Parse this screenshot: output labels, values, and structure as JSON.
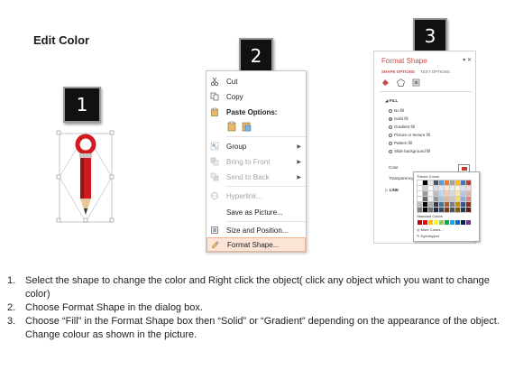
{
  "page_title": "Edit Color",
  "badges": [
    "1",
    "2",
    "3"
  ],
  "context_menu": {
    "cut": "Cut",
    "copy": "Copy",
    "paste_options": "Paste Options:",
    "group": "Group",
    "bring_to_front": "Bring to Front",
    "send_to_back": "Send to Back",
    "hyperlink": "Hyperlink...",
    "save_as_picture": "Save as Picture...",
    "size_and_position": "Size and Position...",
    "format_shape": "Format Shape..."
  },
  "format_pane": {
    "title": "Format Shape",
    "tabs": [
      "SHAPE OPTIONS",
      "TEXT OPTIONS"
    ],
    "fill_section": "FILL",
    "fill_options": [
      "No fill",
      "Solid fill",
      "Gradient fill",
      "Picture or texture fill",
      "Pattern fill",
      "Slide background fill"
    ],
    "selected_fill": "Solid fill",
    "color_label": "Color",
    "transparency_label": "Transparency",
    "line_section": "LINE"
  },
  "color_picker": {
    "theme_colors_label": "Theme Colors",
    "standard_colors_label": "Standard Colors",
    "more_colors": "More Colors...",
    "eyedropper": "Eyedropper",
    "theme_row": [
      "#ffffff",
      "#000000",
      "#e7e6e6",
      "#44546a",
      "#5b9bd5",
      "#ed7d31",
      "#a5a5a5",
      "#ffc000",
      "#4472c4",
      "#c0392b"
    ],
    "standard_colors": [
      "#c00000",
      "#ff0000",
      "#ffc000",
      "#ffff00",
      "#92d050",
      "#00b050",
      "#00b0f0",
      "#0070c0",
      "#002060",
      "#7030a0"
    ]
  },
  "instructions": [
    {
      "num": "1.",
      "text": "Select the shape to change the color and Right click the object( click any object which you want to change color)"
    },
    {
      "num": "2.",
      "text": "Choose Format Shape in the dialog box."
    },
    {
      "num": "3.",
      "text": "Choose “Fill” in the Format Shape box then “Solid” or “Gradient” depending on the appearance of the object. Change colour as shown in the picture."
    }
  ],
  "colors": {
    "pencil_red": "#d11a1f",
    "accent": "#c0504d",
    "highlight": "#fce4d6"
  }
}
